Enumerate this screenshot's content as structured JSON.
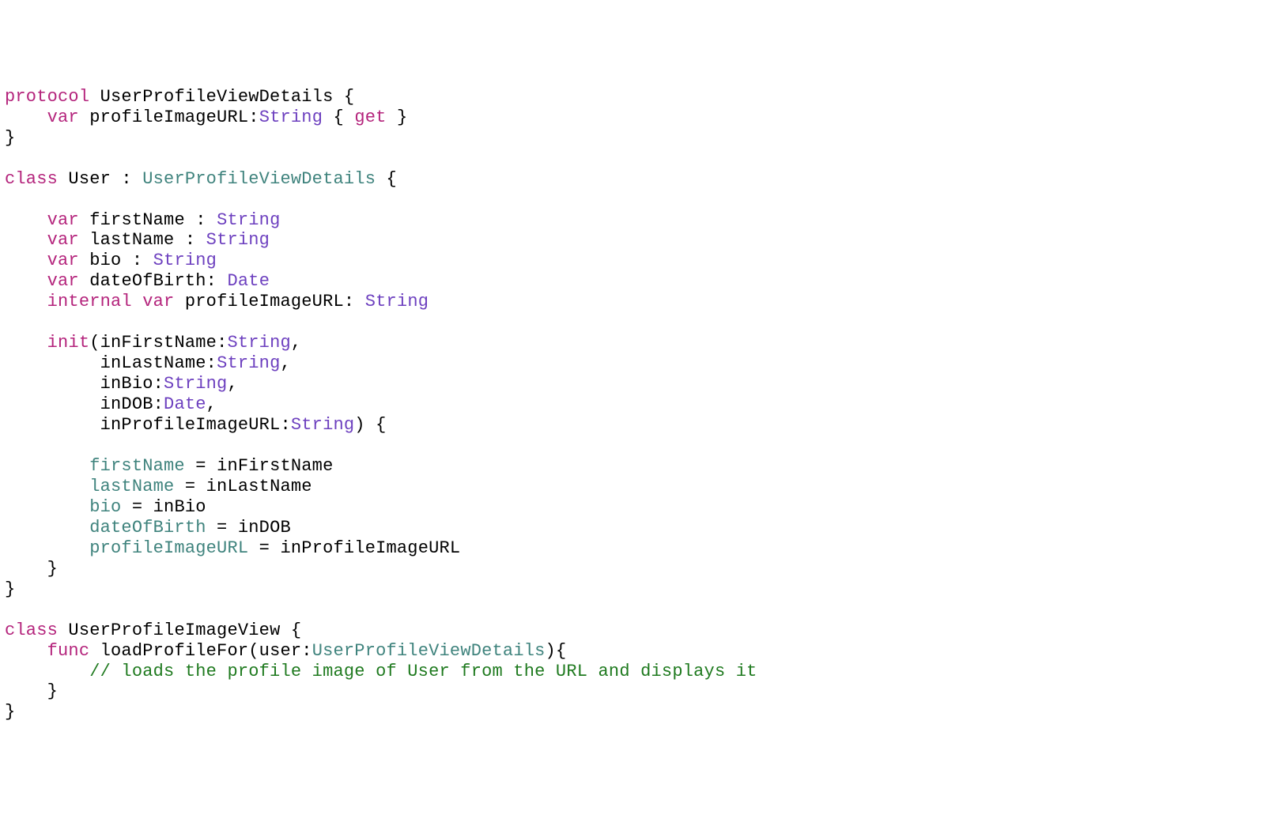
{
  "kw": {
    "protocol": "protocol",
    "var": "var",
    "get": "get",
    "class": "class",
    "internal": "internal",
    "init": "init",
    "func": "func"
  },
  "type": {
    "String": "String",
    "Date": "Date"
  },
  "utype": {
    "UserProfileViewDetails": "UserProfileViewDetails"
  },
  "name": {
    "User": "User",
    "UserProfileImageView": "UserProfileImageView",
    "profileImageURL": "profileImageURL",
    "firstName": "firstName",
    "lastName": "lastName",
    "bio": "bio",
    "dateOfBirth": "dateOfBirth",
    "inFirstName": "inFirstName",
    "inLastName": "inLastName",
    "inBio": "inBio",
    "inDOB": "inDOB",
    "inProfileImageURL": "inProfileImageURL",
    "loadProfileFor": "loadProfileFor",
    "user": "user"
  },
  "mem": {
    "firstName": "firstName",
    "lastName": "lastName",
    "bio": "bio",
    "dateOfBirth": "dateOfBirth",
    "profileImageURL": "profileImageURL"
  },
  "cmt": {
    "load": "// loads the profile image of User from the URL and displays it"
  }
}
